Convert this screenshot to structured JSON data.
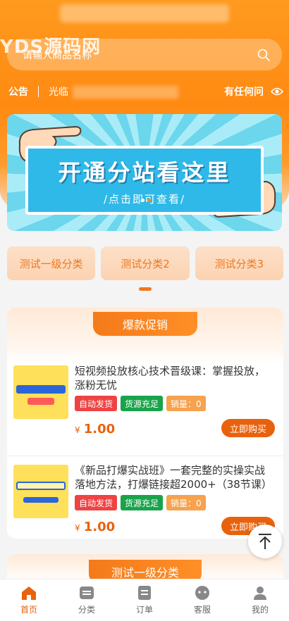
{
  "watermark": "YDS源码网",
  "search": {
    "placeholder": "请输入商品名称"
  },
  "notice": {
    "label": "公告",
    "text": "光临",
    "more": "有任何问"
  },
  "banner": {
    "title": "开通分站看这里",
    "subtitle": "/点击即可查看/"
  },
  "categories": [
    {
      "label": "测试一级分类"
    },
    {
      "label": "测试分类2"
    },
    {
      "label": "测试分类3"
    }
  ],
  "promo": {
    "title": "爆款促销",
    "items": [
      {
        "title": "短视频投放核心技术晋级课：掌握投放，涨粉无忧",
        "tags": [
          "自动发货",
          "货源充足",
          "销量：0"
        ],
        "price_symbol": "¥",
        "price": "1.00",
        "buy_label": "立即购买"
      },
      {
        "title": "《新品打爆实战班》一套完整的实操实战落地方法，打爆链接超2000+（38节课）",
        "tags": [
          "自动发货",
          "货源充足",
          "销量：0"
        ],
        "price_symbol": "¥",
        "price": "1.00",
        "buy_label": "立即购买"
      }
    ]
  },
  "section2": {
    "title": "测试一级分类"
  },
  "tabbar": [
    {
      "label": "首页",
      "icon": "home-icon",
      "active": true
    },
    {
      "label": "分类",
      "icon": "category-icon",
      "active": false
    },
    {
      "label": "订单",
      "icon": "order-icon",
      "active": false
    },
    {
      "label": "客服",
      "icon": "service-icon",
      "active": false
    },
    {
      "label": "我的",
      "icon": "user-icon",
      "active": false
    }
  ],
  "colors": {
    "brand": "#ff8a12",
    "accent": "#e8620d",
    "tag_red": "#ef4343",
    "tag_green": "#1aa34a",
    "tag_orange": "#f6a24e"
  }
}
